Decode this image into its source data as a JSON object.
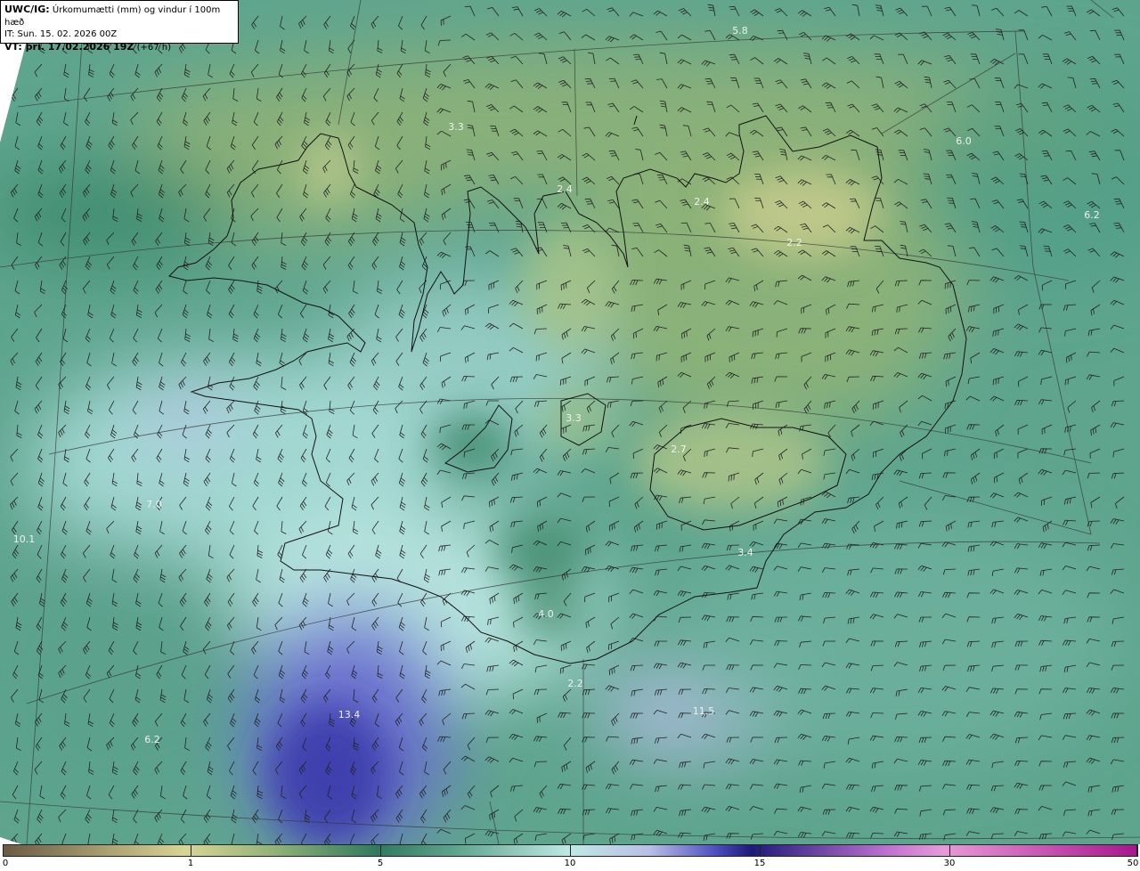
{
  "header": {
    "model": "UWC/IG:",
    "title": "Úrkomumætti (mm) og vindur í 100m hæð",
    "issue_time": "IT: Sun. 15. 02. 2026 00Z",
    "valid_prefix": "VT: þri. 17.02.2026 19Z",
    "valid_offset": "(+67 h)"
  },
  "colors": {
    "brown": "#6b5a44",
    "khaki": "#d9d592",
    "green_mid": "#8fb277",
    "teal_dark": "#2f7a5e",
    "teal": "#5fa58e",
    "cyan_light": "#bfe9e5",
    "lavender": "#b8bfe8",
    "blue": "#4a4cc0",
    "navy": "#1d1a7a",
    "pink": "#e99ad9",
    "magenta": "#a8168f"
  },
  "map_labels": [
    {
      "value": "5.8",
      "lon_lat": [
        1,
        1
      ]
    },
    {
      "value": "3.3",
      "lon_lat": [
        2,
        1
      ]
    },
    {
      "value": "6.0",
      "lon_lat": [
        3,
        1
      ]
    },
    {
      "value": "2.4",
      "lon_lat": [
        4,
        1
      ]
    },
    {
      "value": "2.4",
      "lon_lat": [
        5,
        1
      ]
    },
    {
      "value": "6.2",
      "lon_lat": [
        6,
        1
      ]
    },
    {
      "value": "2.2",
      "lon_lat": [
        7,
        1
      ]
    },
    {
      "value": "3.3",
      "lon_lat": [
        8,
        1
      ]
    },
    {
      "value": "2.7",
      "lon_lat": [
        9,
        1
      ]
    },
    {
      "value": "7.0",
      "lon_lat": [
        10,
        1
      ]
    },
    {
      "value": "10.1",
      "lon_lat": [
        11,
        1
      ]
    },
    {
      "value": "3.4",
      "lon_lat": [
        12,
        1
      ]
    },
    {
      "value": "4.0",
      "lon_lat": [
        13,
        1
      ]
    },
    {
      "value": "2.2",
      "lon_lat": [
        14,
        1
      ]
    },
    {
      "value": "13.4",
      "lon_lat": [
        15,
        1
      ]
    },
    {
      "value": "11.5",
      "lon_lat": [
        16,
        1
      ]
    },
    {
      "value": "6.2",
      "lon_lat": [
        17,
        1
      ]
    }
  ],
  "scale": {
    "ticks": [
      "0",
      "1",
      "5",
      "10",
      "15",
      "30",
      "50"
    ]
  }
}
